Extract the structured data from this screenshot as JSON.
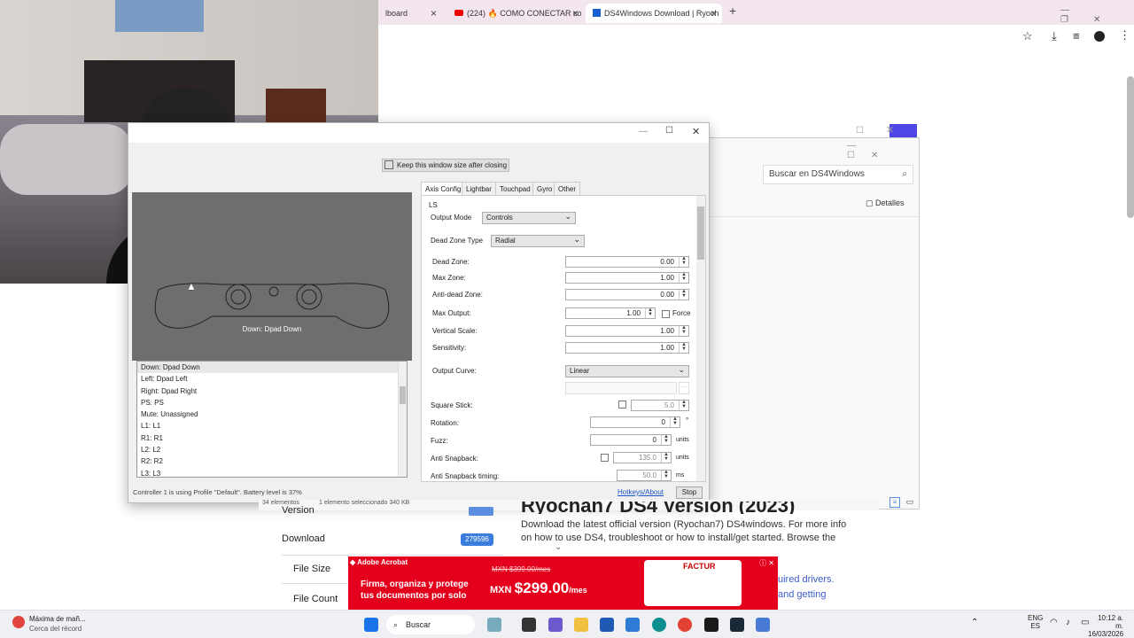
{
  "browser": {
    "tabs": [
      {
        "label": "lboard",
        "active": false
      },
      {
        "label": "(224) 🔥 COMO CONECTAR co",
        "active": false
      },
      {
        "label": "DS4Windows Download | Ryoch",
        "active": true
      }
    ],
    "new_tab": "+",
    "window_controls": [
      "—",
      "❐",
      "✕"
    ]
  },
  "ds4": {
    "window_controls": [
      "—",
      "☐",
      "✕"
    ],
    "keep_size": "Keep this window size after closing",
    "tabs": [
      "Axis Config",
      "Lightbar",
      "Touchpad",
      "Gyro",
      "Other"
    ],
    "section": "LS",
    "output_mode_label": "Output Mode",
    "output_mode_value": "Controls",
    "dead_zone_type_label": "Dead Zone Type",
    "dead_zone_type_value": "Radial",
    "dead_zone_label": "Dead Zone:",
    "dead_zone_value": "0.00",
    "max_zone_label": "Max Zone:",
    "max_zone_value": "1.00",
    "anti_dead_label": "Anti-dead Zone:",
    "anti_dead_value": "0.00",
    "max_output_label": "Max Output:",
    "max_output_value": "1.00",
    "force_label": "Force",
    "vertical_scale_label": "Vertical Scale:",
    "vertical_scale_value": "1.00",
    "sensitivity_label": "Sensitivity:",
    "sensitivity_value": "1.00",
    "output_curve_label": "Output Curve:",
    "output_curve_value": "Linear",
    "square_stick_label": "Square Stick:",
    "square_stick_value": "5.0",
    "rotation_label": "Rotation:",
    "rotation_value": "0",
    "rotation_unit": "°",
    "fuzz_label": "Fuzz:",
    "fuzz_value": "0",
    "fuzz_unit": "units",
    "anti_snapback_label": "Anti Snapback:",
    "anti_snapback_value": "135.0",
    "anti_snapback_unit": "units",
    "anti_snapback_timing_label": "Anti Snapback timing:",
    "anti_snapback_timing_value": "50.0",
    "anti_snapback_timing_unit": "ms",
    "controller_caption": "Down: Dpad Down",
    "mappings": [
      "Down: Dpad Down",
      "Left: Dpad Left",
      "Right: Dpad Right",
      "PS: PS",
      "Mute: Unassigned",
      "L1: L1",
      "R1: R1",
      "L2: L2",
      "R2: R2",
      "L3: L3"
    ],
    "status": "Controller 1 is using Profile \"Default\". Battery level is 37%",
    "hotkeys": "Hotkeys/About",
    "stop": "Stop"
  },
  "explorer": {
    "search_placeholder": "Buscar en DS4Windows",
    "details": "Detalles",
    "status_count": "34 elementos",
    "status_selected": "1 elemento seleccionado  340 KB",
    "window_controls": [
      "—",
      "☐",
      "✕"
    ]
  },
  "site": {
    "version_label": "Version",
    "download_label": "Download",
    "download_count": "279596",
    "file_size_label": "File Size",
    "file_count_label": "File Count",
    "description": "Download the latest official version (Ryochan7) DS4windows. For more info on how to use DS4, troubleshoot or how to install/get started. Browse the",
    "right_text_1": "uired drivers.",
    "right_text_2": "and getting",
    "heading_fragment": "Ryochan7 DS4 Version (2023)"
  },
  "ad": {
    "brand": "Adobe Acrobat",
    "line1": "Firma, organiza y protege",
    "line2": "tus documentos por solo",
    "old_price": "MXN $399.00/mes",
    "currency": "MXN",
    "price": "$299.00",
    "per": "/mes",
    "badge": "FACTUR"
  },
  "taskbar": {
    "weather_title": "Máxima de mañ...",
    "weather_sub": "Cerca del récord",
    "search": "Buscar",
    "lang": "ENG",
    "region": "ES",
    "time": "10:12 a. m.",
    "date": "16/03/2026"
  }
}
